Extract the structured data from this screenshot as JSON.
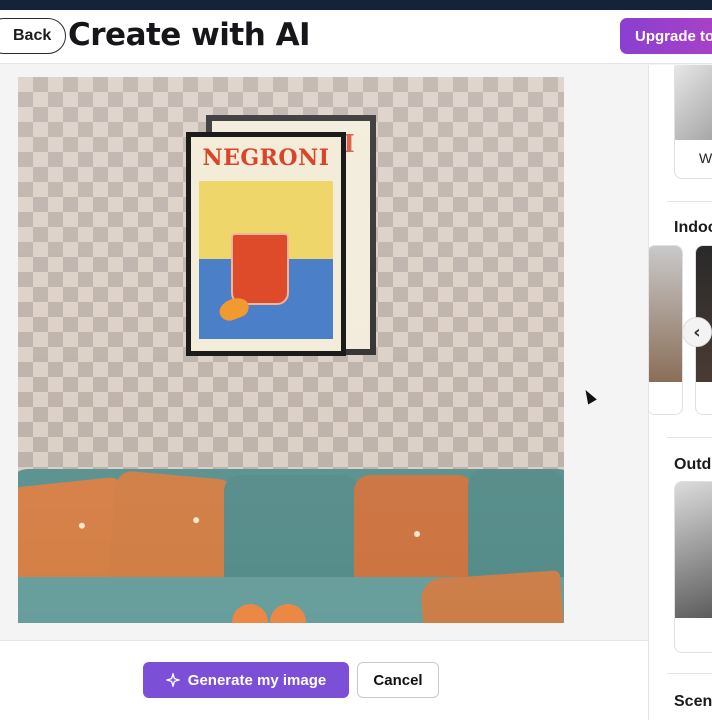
{
  "header": {
    "back_label": "Back",
    "title": "Create with AI",
    "upgrade_label": "Upgrade to"
  },
  "canvas": {
    "poster_text": "NEGRONI"
  },
  "footer": {
    "generate_label": "Generate my image",
    "cancel_label": "Cancel"
  },
  "sidebar": {
    "first_card_label": "W",
    "sections": [
      "Indoor",
      "Outdoor",
      "Scenes"
    ]
  },
  "icons": {
    "generate": "sparkle-icon",
    "carousel_prev": "chevron-left-icon",
    "pointer": "cursor-icon"
  },
  "colors": {
    "accent": "#7b4fd6",
    "upgrade_gradient_start": "#8a3fd1",
    "upgrade_gradient_end": "#b042c4",
    "header_bar": "#15233a"
  }
}
